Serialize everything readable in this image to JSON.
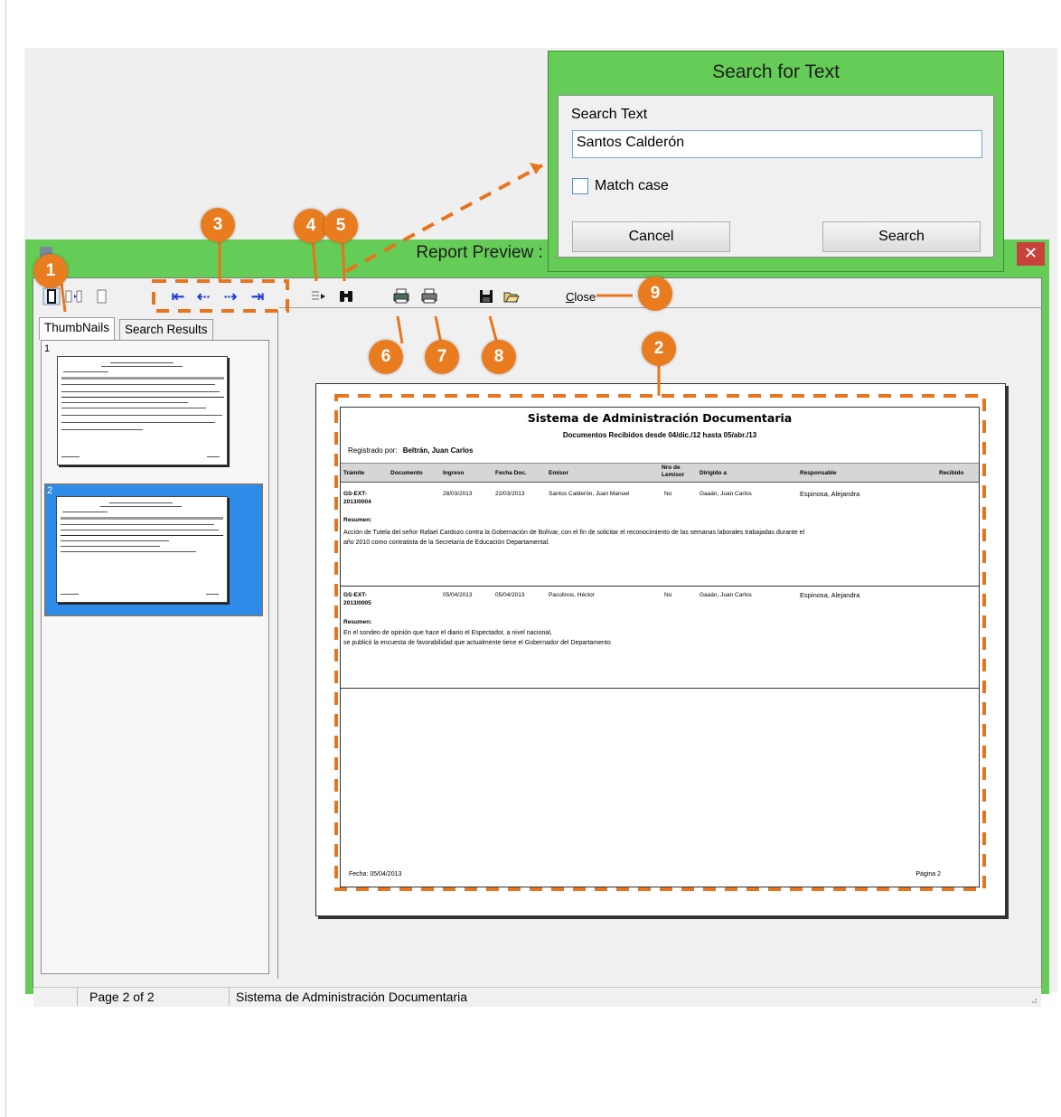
{
  "report_window": {
    "title": "Report Preview : Sistema de Ad",
    "close_glyph": "✕",
    "toolbar": {
      "close_label": "Close",
      "close_mnemonic": "C",
      "close_rest": "lose",
      "nav_first": "⇤",
      "nav_prev": "⇠",
      "nav_next": "⇢",
      "nav_last": "⇥"
    },
    "tabs": [
      {
        "label": "ThumbNails",
        "active": true
      },
      {
        "label": "Search Results",
        "active": false
      }
    ],
    "thumbnail_numbers": [
      "1",
      "2"
    ],
    "status_bar": {
      "page_info": "Page 2 of 2",
      "report_name": "Sistema de Administración Documentaria"
    }
  },
  "report": {
    "title": "Sistema de Administración Documentaria",
    "subtitle": "Documentos Recibidos desde 04/dic./12 hasta 05/abr./13",
    "registered_by_label": "Registrado por:",
    "registered_by_value": "Beltrán, Juan Carlos",
    "columns": [
      "Trámite",
      "Documento",
      "Ingreso",
      "Fecha Doc.",
      "Emisor",
      "Nro de Lemisor",
      "Dirigido a",
      "Responsable",
      "Recibido"
    ],
    "rows": [
      {
        "tramite": "GS-EXT-2013/0004",
        "ingreso": "28/03/2013",
        "fecha_doc": "22/03/2013",
        "emisor": "Santos Calderón, Juan Manuel",
        "nro": "No",
        "dirigido": "Gaaán, Juan Carlos",
        "responsable": "Espinosa, Alejandra",
        "resumen_label": "Resumen:",
        "resumen_lines": [
          "Acción de Tutela del señor Rafael Cardozo contra la Gobernación de Bolívar, con el fin de solicitar el reconocimiento de las semanas laborales trabajadas durante el",
          "año 2010 como contratista de la Secretaría de Educación Departamental."
        ]
      },
      {
        "tramite": "GS-EXT-2013/0005",
        "ingreso": "05/04/2013",
        "fecha_doc": "05/04/2013",
        "emisor": "Pacolinos, Héctor",
        "nro": "No",
        "dirigido": "Gaaán, Juan Carlos",
        "responsable": "Espinosa, Alejandra",
        "resumen_label": "Resumen:",
        "resumen_lines": [
          "En el sondeo de opinión que hace el diario el Espectador, a nivel nacional,",
          "se publicó la encuesta de favorabilidad que actualmente tiene el Gobernador del Departamento"
        ]
      }
    ],
    "footer_date": "Fecha: 05/04/2013",
    "footer_page": "Página 2"
  },
  "search_dialog": {
    "title": "Search for Text",
    "search_label": "Search Text",
    "search_value": "Santos Calderón",
    "match_case_label": "Match case",
    "match_case_checked": false,
    "cancel_label": "Cancel",
    "search_button_label": "Search"
  },
  "callouts": [
    "1",
    "2",
    "3",
    "4",
    "5",
    "6",
    "7",
    "8",
    "9"
  ],
  "colors": {
    "window_frame": "#65cc57",
    "callout": "#e97c1f",
    "nav_arrows": "#1f3bd8",
    "thumb_selected": "#2e8ce8"
  }
}
